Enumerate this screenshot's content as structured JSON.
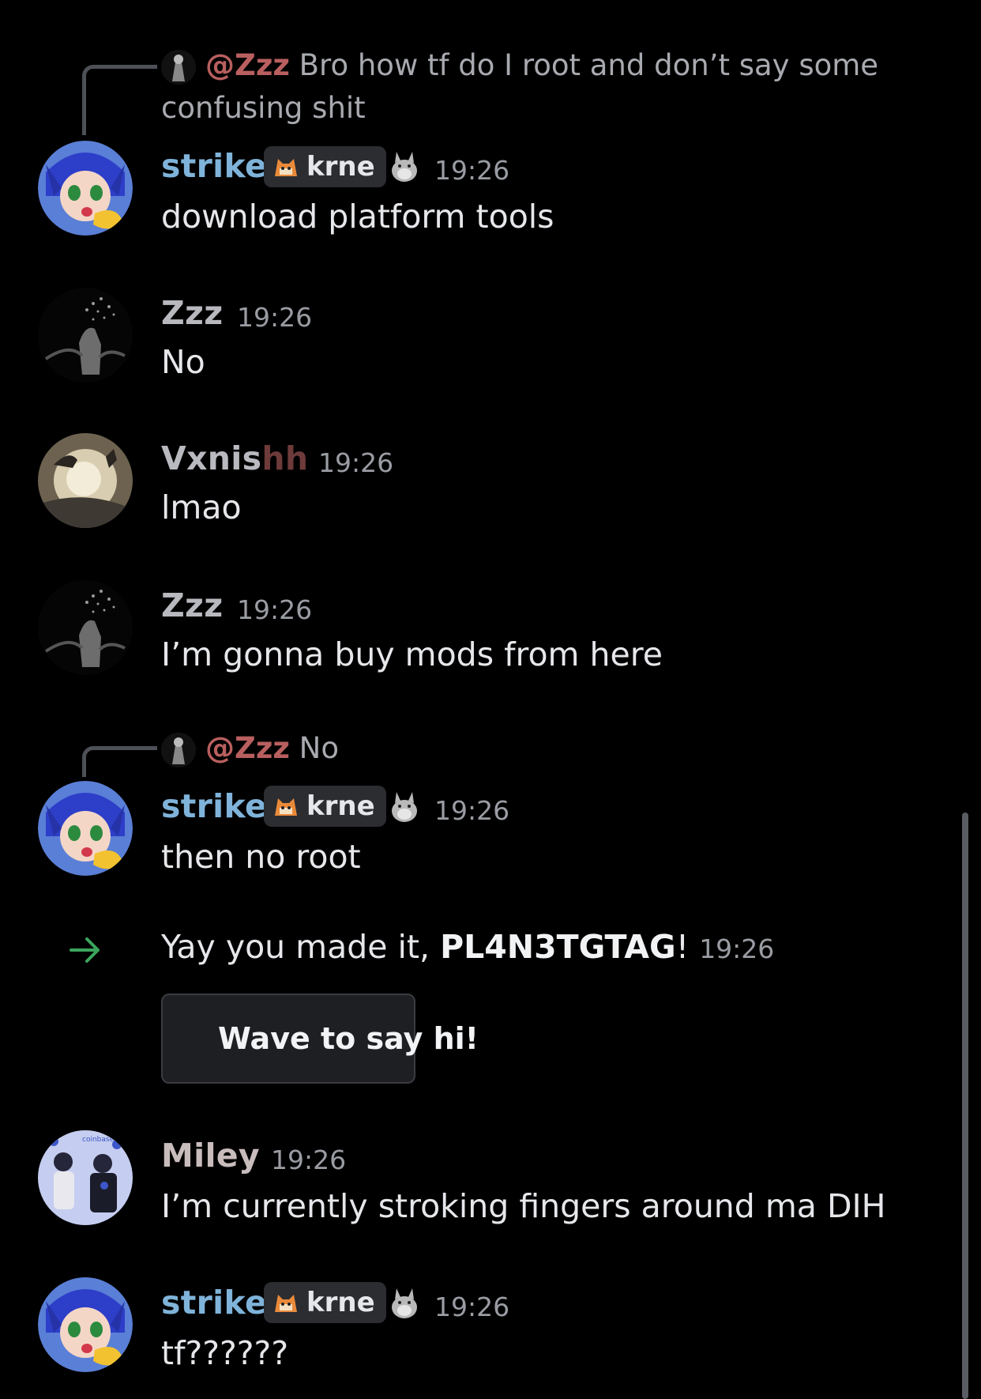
{
  "messages": {
    "m1": {
      "reply_author": "@Zzz",
      "reply_text_line1": "Bro how tf do I root and don’t say some",
      "reply_text_line2": "confusing shit",
      "author": "strike",
      "tag": "krne",
      "time": "19:26",
      "text": "download platform tools"
    },
    "m2": {
      "author": "Zzz",
      "time": "19:26",
      "text": "No"
    },
    "m3": {
      "author_a": "Vxnis",
      "author_b": "hh",
      "time": "19:26",
      "text": "lmao"
    },
    "m4": {
      "author": "Zzz",
      "time": "19:26",
      "text": "I’m gonna buy mods from here"
    },
    "m5": {
      "reply_author": "@Zzz",
      "reply_text": "No",
      "author": "strike",
      "tag": "krne",
      "time": "19:26",
      "text": "then no root"
    },
    "join": {
      "prefix": "Yay you made it, ",
      "user": "PL4N3TGTAG",
      "suffix": "!",
      "time": "19:26",
      "button_label": "Wave to say hi!"
    },
    "m6": {
      "author": "Miley",
      "time": "19:26",
      "text": "I’m currently stroking fingers around ma DIH"
    },
    "m7": {
      "author": "strike",
      "tag": "krne",
      "time": "19:26",
      "text": "tf??????"
    }
  },
  "colors": {
    "strike": "#7fb3d9",
    "zzz": "#b8b9bf",
    "vxnishh_a": "#b9babf",
    "vxnishh_b": "#6e3a3a",
    "miley": "#c9bcbc",
    "join_arrow": "#3ba55d",
    "mention": "#b95f5f"
  },
  "icons": [
    "fox-tag-icon",
    "totoro-badge-icon",
    "join-arrow-icon",
    "wave-sticker-icon"
  ]
}
